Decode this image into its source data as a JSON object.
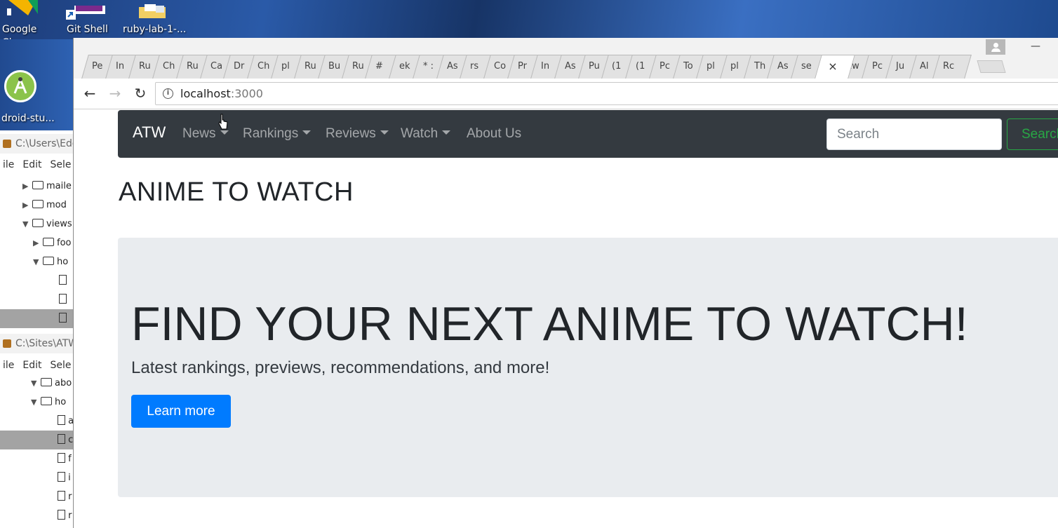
{
  "desktop": {
    "icons": [
      {
        "label_line1": "Google",
        "label_line2": "Chrome"
      },
      {
        "label_line1": "Git Shell",
        "label_line2": ""
      },
      {
        "label_line1": "ruby-lab-1-...",
        "label_line2": ""
      }
    ],
    "android_label": "droid-stu..."
  },
  "background_windows": {
    "window1": {
      "title": "C:\\Users\\Edo",
      "menu": [
        "ile",
        "Edit",
        "Sele"
      ],
      "tree": [
        {
          "label": "maile",
          "kind": "folder",
          "expanded": false,
          "depth": 0
        },
        {
          "label": "mod",
          "kind": "folder",
          "expanded": false,
          "depth": 0
        },
        {
          "label": "views",
          "kind": "folder",
          "expanded": true,
          "depth": 0
        },
        {
          "label": "foo",
          "kind": "folder",
          "expanded": false,
          "depth": 1
        },
        {
          "label": "ho",
          "kind": "folder",
          "expanded": true,
          "depth": 1
        },
        {
          "label": "",
          "kind": "file",
          "depth": 2
        },
        {
          "label": "",
          "kind": "file",
          "depth": 2
        },
        {
          "label": "",
          "kind": "file",
          "depth": 2,
          "selected": true
        }
      ]
    },
    "window2": {
      "title": "C:\\Sites\\ATW",
      "menu": [
        "ile",
        "Edit",
        "Sele"
      ],
      "tree": [
        {
          "label": "abo",
          "kind": "folder",
          "expanded": true,
          "depth": 1
        },
        {
          "label": "ho",
          "kind": "folder",
          "expanded": true,
          "depth": 1
        },
        {
          "label": "a",
          "kind": "file",
          "depth": 2
        },
        {
          "label": "c",
          "kind": "file",
          "depth": 2,
          "selected": true
        },
        {
          "label": "f",
          "kind": "file",
          "depth": 2
        },
        {
          "label": "i",
          "kind": "file",
          "depth": 2
        },
        {
          "label": "r",
          "kind": "file",
          "depth": 2
        },
        {
          "label": "r",
          "kind": "file",
          "depth": 2
        }
      ]
    }
  },
  "browser": {
    "tabs": [
      "Pe",
      "In",
      "Ru",
      "Ch",
      "Ru",
      "Ca",
      "Dr",
      "Ch",
      "pl",
      "Ru",
      "Bu",
      "Ru",
      "#",
      "ek",
      "* :",
      "As",
      "rs",
      "Co",
      "Pr",
      "In",
      "As",
      "Pu",
      "(1",
      "(1",
      "Pc",
      "To",
      "pl",
      "pl",
      "Th",
      "As",
      "se",
      "×",
      "tw",
      "Pc",
      "Ju",
      "Al",
      "Rc"
    ],
    "active_tab_index": 31,
    "window_controls": {
      "minimize": "—"
    },
    "address": {
      "host": "localhost",
      "port": ":3000"
    },
    "nav_icons": {
      "back": "←",
      "forward": "→",
      "reload": "↻",
      "info": "i",
      "chevron": "⌄"
    }
  },
  "page": {
    "navbar": {
      "brand": "ATW",
      "items": [
        {
          "label": "News",
          "dropdown": true
        },
        {
          "label": "Rankings",
          "dropdown": true
        },
        {
          "label": "Reviews",
          "dropdown": true
        },
        {
          "label": "Watch",
          "dropdown": true
        },
        {
          "label": "About Us",
          "dropdown": false
        }
      ],
      "search_placeholder": "Search",
      "search_button": "Search"
    },
    "title": "ANIME TO WATCH",
    "jumbotron": {
      "heading": "FIND YOUR NEXT ANIME TO WATCH!",
      "lead": "Latest rankings, previews, recommendations, and more!",
      "button": "Learn more"
    }
  },
  "colors": {
    "navbar_bg": "#343a40",
    "jumbotron_bg": "#e9ecef",
    "primary": "#007bff",
    "success": "#28a745"
  }
}
